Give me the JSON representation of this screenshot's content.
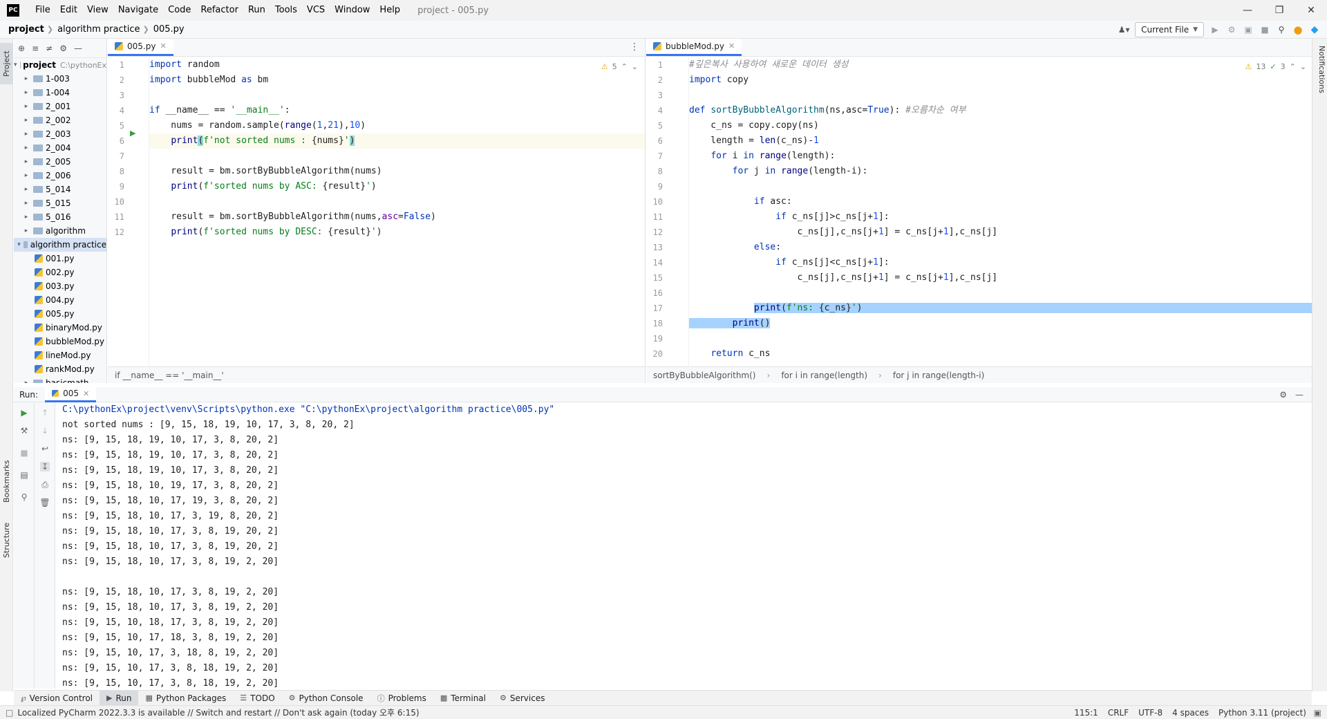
{
  "app": {
    "logo": "PC",
    "window_title": "project - 005.py"
  },
  "menu": [
    "File",
    "Edit",
    "View",
    "Navigate",
    "Code",
    "Refactor",
    "Run",
    "Tools",
    "VCS",
    "Window",
    "Help"
  ],
  "breadcrumb": [
    "project",
    "algorithm practice",
    "005.py"
  ],
  "nav": {
    "run_config": "Current File"
  },
  "project_tree": {
    "root_label": "project",
    "root_path": "C:\\pythonEx",
    "folders": [
      "1-003",
      "1-004",
      "2_001",
      "2_002",
      "2_003",
      "2_004",
      "2_005",
      "2_006",
      "5_014",
      "5_015",
      "5_016",
      "algorithm"
    ],
    "open_folder": "algorithm practice",
    "files": [
      "001.py",
      "002.py",
      "003.py",
      "004.py",
      "005.py",
      "binaryMod.py",
      "bubbleMod.py",
      "lineMod.py",
      "rankMod.py"
    ],
    "next_folder": "basicmath"
  },
  "left_strip": {
    "project": "Project",
    "bookmarks": "Bookmarks",
    "structure": "Structure"
  },
  "right_strip": {
    "notifications": "Notifications"
  },
  "editor_left": {
    "tab": "005.py",
    "warnings": "5",
    "breadcrumb": "if __name__ == '__main__'",
    "line_numbers": [
      "1",
      "2",
      "3",
      "4",
      "5",
      "6",
      "7",
      "8",
      "9",
      "10",
      "11",
      "12"
    ]
  },
  "editor_right": {
    "tab": "bubbleMod.py",
    "warnings": "13",
    "checks": "3",
    "breadcrumb": [
      "sortByBubbleAlgorithm()",
      "for i in range(length)",
      "for j in range(length-i)"
    ],
    "line_numbers": [
      "1",
      "2",
      "3",
      "4",
      "5",
      "6",
      "7",
      "8",
      "9",
      "10",
      "11",
      "12",
      "13",
      "14",
      "15",
      "16",
      "17",
      "18",
      "19",
      "20"
    ],
    "comment_1": "#깊은복사 사용하여 새로운 데이터 생성",
    "comment_4": "#오름차순 여부"
  },
  "run": {
    "label": "Run:",
    "tab": "005",
    "command": "C:\\pythonEx\\project\\venv\\Scripts\\python.exe \"C:\\pythonEx\\project\\algorithm practice\\005.py\"",
    "lines": [
      "not sorted nums : [9, 15, 18, 19, 10, 17, 3, 8, 20, 2]",
      "ns: [9, 15, 18, 19, 10, 17, 3, 8, 20, 2]",
      "ns: [9, 15, 18, 19, 10, 17, 3, 8, 20, 2]",
      "ns: [9, 15, 18, 19, 10, 17, 3, 8, 20, 2]",
      "ns: [9, 15, 18, 10, 19, 17, 3, 8, 20, 2]",
      "ns: [9, 15, 18, 10, 17, 19, 3, 8, 20, 2]",
      "ns: [9, 15, 18, 10, 17, 3, 19, 8, 20, 2]",
      "ns: [9, 15, 18, 10, 17, 3, 8, 19, 20, 2]",
      "ns: [9, 15, 18, 10, 17, 3, 8, 19, 20, 2]",
      "ns: [9, 15, 18, 10, 17, 3, 8, 19, 2, 20]",
      "",
      "ns: [9, 15, 18, 10, 17, 3, 8, 19, 2, 20]",
      "ns: [9, 15, 18, 10, 17, 3, 8, 19, 2, 20]",
      "ns: [9, 15, 10, 18, 17, 3, 8, 19, 2, 20]",
      "ns: [9, 15, 10, 17, 18, 3, 8, 19, 2, 20]",
      "ns: [9, 15, 10, 17, 3, 18, 8, 19, 2, 20]",
      "ns: [9, 15, 10, 17, 3, 8, 18, 19, 2, 20]",
      "ns: [9, 15, 10, 17, 3, 8, 18, 19, 2, 20]"
    ]
  },
  "bottom_tools": [
    "Version Control",
    "Run",
    "Python Packages",
    "TODO",
    "Python Console",
    "Problems",
    "Terminal",
    "Services"
  ],
  "status": {
    "message": "Localized PyCharm 2022.3.3 is available // Switch and restart // Don't ask again (today 오후 6:15)",
    "position": "115:1",
    "line_sep": "CRLF",
    "encoding": "UTF-8",
    "indent": "4 spaces",
    "interpreter": "Python 3.11 (project)"
  },
  "colors": {
    "accent": "#3574f0",
    "selection": "#a6d2ff",
    "keyword": "#0033b3",
    "string": "#067d17",
    "number": "#1750eb"
  }
}
